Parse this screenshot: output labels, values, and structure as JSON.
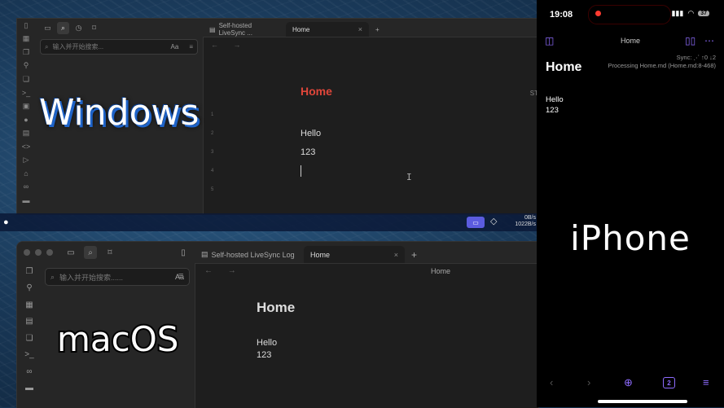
{
  "labels": {
    "windows": "Windows",
    "macos": "macOS",
    "iphone": "iPhone"
  },
  "windows": {
    "search_placeholder": "输入并开始搜索...",
    "search_case": "Aa",
    "tabs": [
      {
        "label": "Self-hosted LiveSync ..."
      },
      {
        "label": "Home",
        "close": "×"
      }
    ],
    "new_tab": "+",
    "nav_arrows": "← →",
    "note_title": "Home",
    "right_cut_text": "ST",
    "line_numbers": [
      "1",
      "2",
      "3",
      "4",
      "5"
    ],
    "lines": [
      "Hello",
      "123"
    ],
    "cursor_glyph": "I"
  },
  "menubar": {
    "apple": "",
    "speed_top": "0B/s",
    "speed_bottom": "1022B/s"
  },
  "mac": {
    "search_placeholder": "输入并开始搜索......",
    "search_case": "Aa",
    "tabs": [
      {
        "label": "Self-hosted LiveSync Log"
      },
      {
        "label": "Home",
        "close": "×"
      }
    ],
    "new_tab": "+",
    "nav_arrows": "← →",
    "breadcrumb": "Home",
    "note_title": "Home",
    "lines": [
      "Hello",
      "123"
    ]
  },
  "iphone": {
    "time": "19:08",
    "battery": "37",
    "header_title": "Home",
    "sync_status": "Sync: ⋰ ↑0 ↓2",
    "processing": "Processing Home.md (Home.md:8-468)",
    "note_title": "Home",
    "lines": [
      "Hello",
      "123"
    ],
    "tab_count": "2"
  },
  "colors": {
    "accent_purple": "#8e6cff",
    "windows_title_red": "#e0463a",
    "mac_badge": "#5b5ce0"
  }
}
